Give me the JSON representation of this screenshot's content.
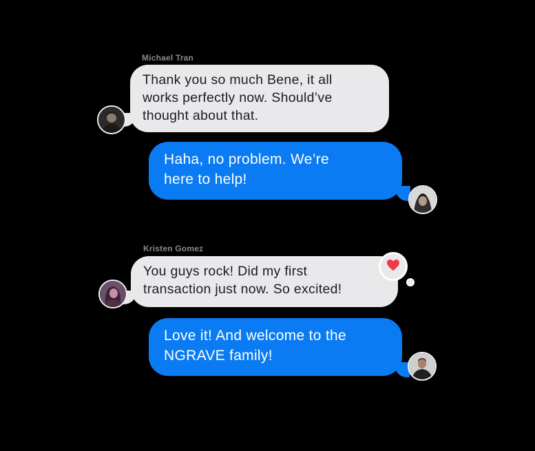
{
  "conversation": [
    {
      "sender_name": "Michael Tran",
      "direction": "incoming",
      "text": "Thank you so much Bene, it all\nworks perfectly now. Should’ve\nthought about that.",
      "avatar_icon": "user-avatar-icon"
    },
    {
      "direction": "outgoing",
      "text": "Haha, no problem. We’re\nhere to help!",
      "avatar_icon": "agent-avatar-icon"
    },
    {
      "sender_name": "Kristen Gomez",
      "direction": "incoming",
      "text": "You guys rock! Did my first\ntransaction just now. So excited!",
      "avatar_icon": "user-avatar-icon",
      "reaction": "heart-icon"
    },
    {
      "direction": "outgoing",
      "text": "Love it! And welcome to the\nNGRAVE family!",
      "avatar_icon": "agent-avatar-icon"
    }
  ],
  "colors": {
    "background": "#000000",
    "incoming_bubble": "#e9e9eb",
    "outgoing_bubble": "#0a7bf3",
    "heart": "#ee3a4a"
  }
}
